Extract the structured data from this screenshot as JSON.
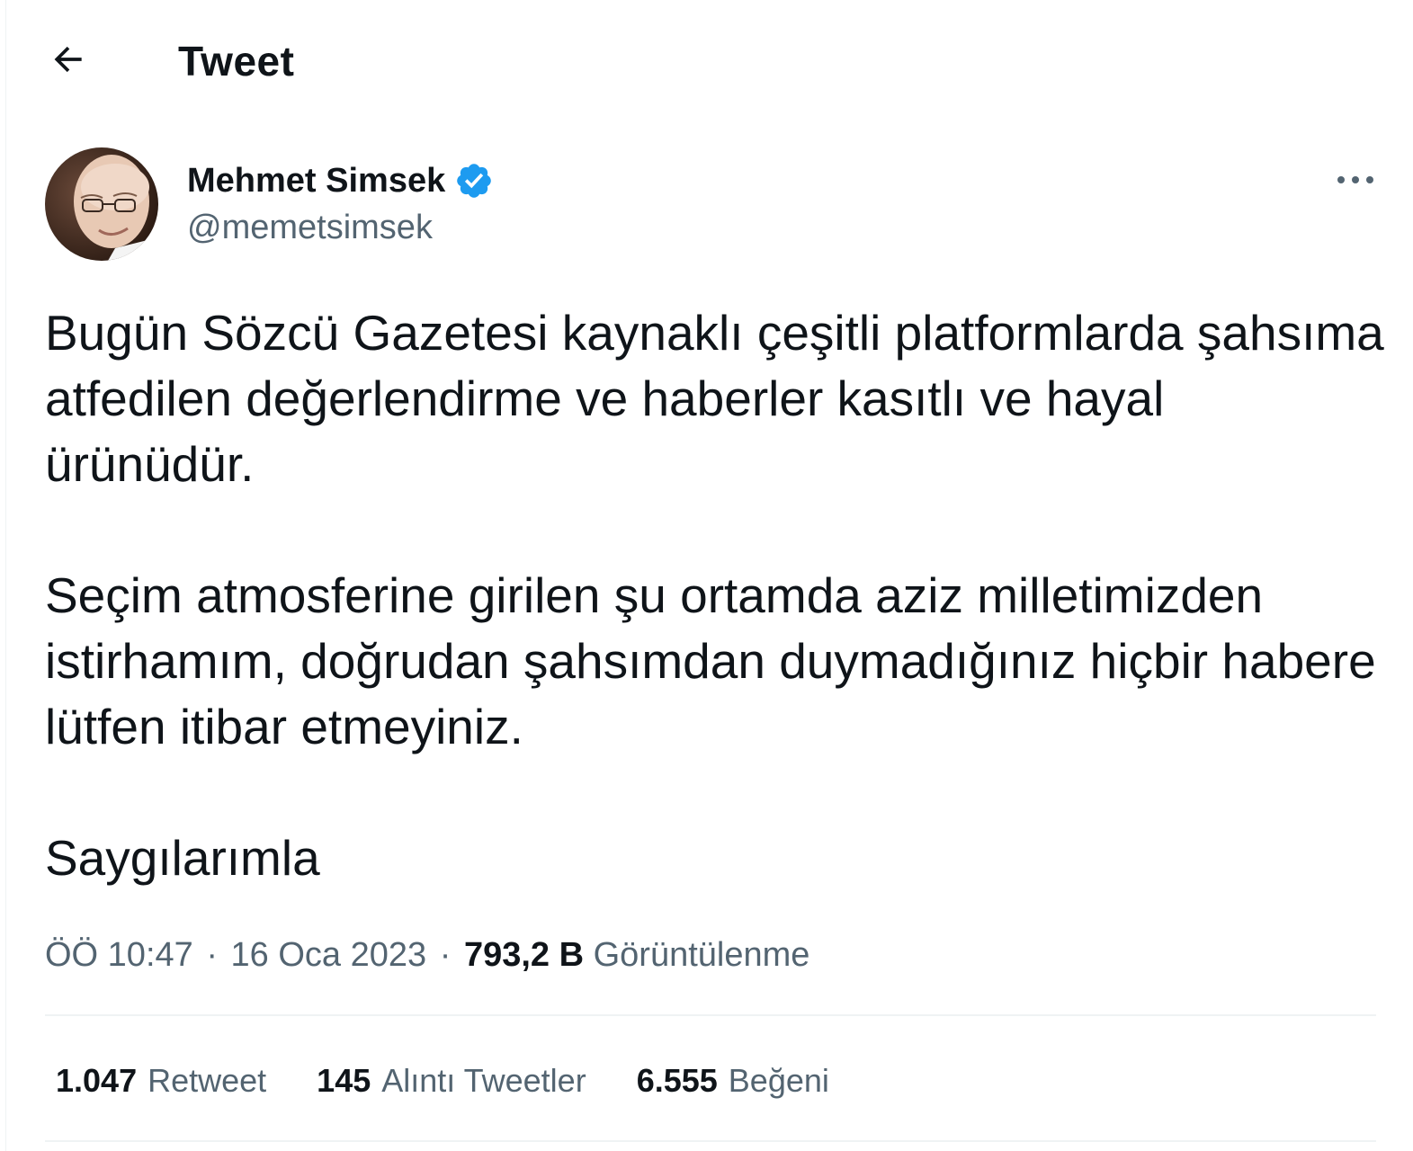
{
  "header": {
    "title": "Tweet",
    "back_icon": "arrow-left-icon"
  },
  "author": {
    "name": "Mehmet Simsek",
    "handle": "@memetsimsek",
    "verified": true,
    "verified_color": "#1d9bf0",
    "avatar_icon": "profile-photo"
  },
  "tweet": {
    "paragraphs": [
      "Bugün Sözcü Gazetesi kaynaklı çeşitli platformlarda şahsıma atfedilen değerlendirme ve haberler kasıtlı ve hayal ürünüdür.",
      "Seçim atmosferine girilen şu ortamda aziz milletimizden istirhamım, doğrudan şahsımdan duymadığınız hiçbir habere lütfen itibar etmeyiniz.",
      "Saygılarımla"
    ]
  },
  "meta": {
    "time": "ÖÖ 10:47",
    "separator": "·",
    "date": "16 Oca 2023",
    "views_count": "793,2 B",
    "views_label": "Görüntülenme"
  },
  "stats": {
    "retweets": {
      "count": "1.047",
      "label": "Retweet"
    },
    "quotes": {
      "count": "145",
      "label": "Alıntı Tweetler"
    },
    "likes": {
      "count": "6.555",
      "label": "Beğeni"
    }
  },
  "colors": {
    "text_primary": "#0f1419",
    "text_secondary": "#536471",
    "divider": "#eff3f4",
    "accent": "#1d9bf0"
  }
}
